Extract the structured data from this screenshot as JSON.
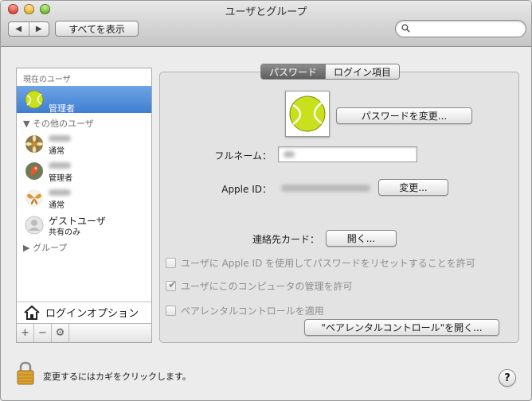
{
  "window": {
    "title": "ユーザとグループ"
  },
  "toolbar": {
    "back_glyph": "◀",
    "forward_glyph": "▶",
    "show_all_label": "すべてを表示",
    "search_placeholder": ""
  },
  "sidebar": {
    "current_user_header": "現在のユーザ",
    "current_user": {
      "name": "",
      "role": "管理者"
    },
    "other_users_header": "▼ その他のユーザ",
    "other_users": [
      {
        "name": "",
        "role": "通常",
        "avatar": "flower-icon"
      },
      {
        "name": "",
        "role": "管理者",
        "avatar": "parrot-icon"
      },
      {
        "name": "",
        "role": "通常",
        "avatar": "butterfly-icon"
      },
      {
        "name": "ゲストユーザ",
        "role": "共有のみ",
        "avatar": "guest-icon"
      }
    ],
    "groups_label": "▶ グループ",
    "login_options_label": "ログインオプション",
    "footer": {
      "add": "+",
      "remove": "−",
      "gear": "⚙"
    }
  },
  "tabs": [
    {
      "label": "パスワード",
      "active": true
    },
    {
      "label": "ログイン項目",
      "active": false
    }
  ],
  "password_panel": {
    "change_password_label": "パスワードを変更...",
    "fullname_label": "フルネーム：",
    "fullname_value": "",
    "appleid_label": "Apple ID：",
    "appleid_change_label": "変更...",
    "contact_card_label": "連絡先カード：",
    "open_label": "開く...",
    "checkboxes": [
      {
        "label": "ユーザに Apple ID を使用してパスワードをリセットすることを許可",
        "checked": false,
        "enabled": false
      },
      {
        "label": "ユーザにこのコンピュータの管理を許可",
        "checked": true,
        "enabled": false
      },
      {
        "label": "ペアレンタルコントロールを適用",
        "checked": false,
        "enabled": false
      }
    ],
    "open_parental_label": "\"ペアレンタルコントロール\"を開く..."
  },
  "footer": {
    "lock_text": "変更するにはカギをクリックします。",
    "help_label": "?"
  },
  "colors": {
    "selection": "#3f7ed0",
    "tennis_ball": "#c9e11c"
  }
}
